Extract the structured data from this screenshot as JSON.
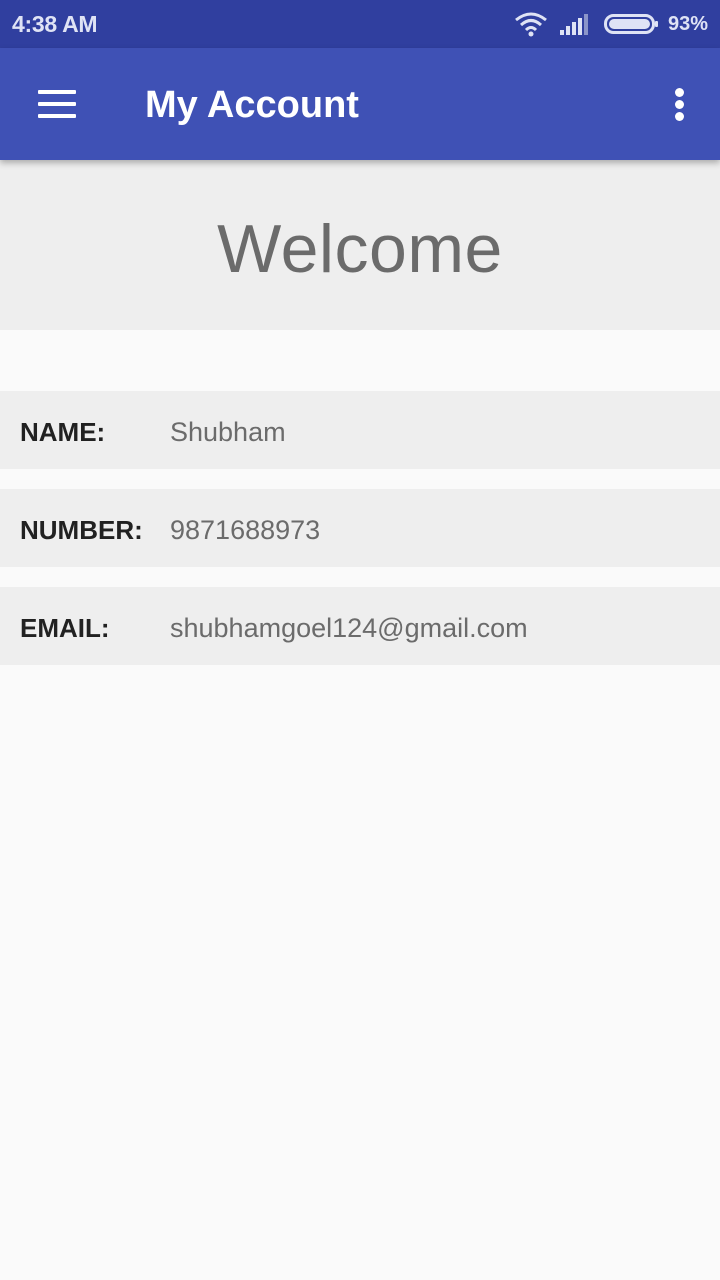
{
  "status_bar": {
    "time": "4:38 AM",
    "battery": "93%",
    "icons": [
      "wifi-icon",
      "signal-icon",
      "battery-icon"
    ]
  },
  "app_bar": {
    "title": "My Account",
    "menu_icon": "hamburger-menu-icon",
    "overflow_icon": "more-vertical-icon"
  },
  "welcome": {
    "heading": "Welcome"
  },
  "profile": {
    "fields": [
      {
        "label": "NAME:",
        "value": "Shubham"
      },
      {
        "label": "NUMBER:",
        "value": "9871688973"
      },
      {
        "label": "EMAIL:",
        "value": "shubhamgoel124@gmail.com"
      }
    ]
  },
  "colors": {
    "status_bar": "#303f9f",
    "app_bar": "#3f51b5",
    "panel": "#eeeeee",
    "background": "#fafafa"
  }
}
